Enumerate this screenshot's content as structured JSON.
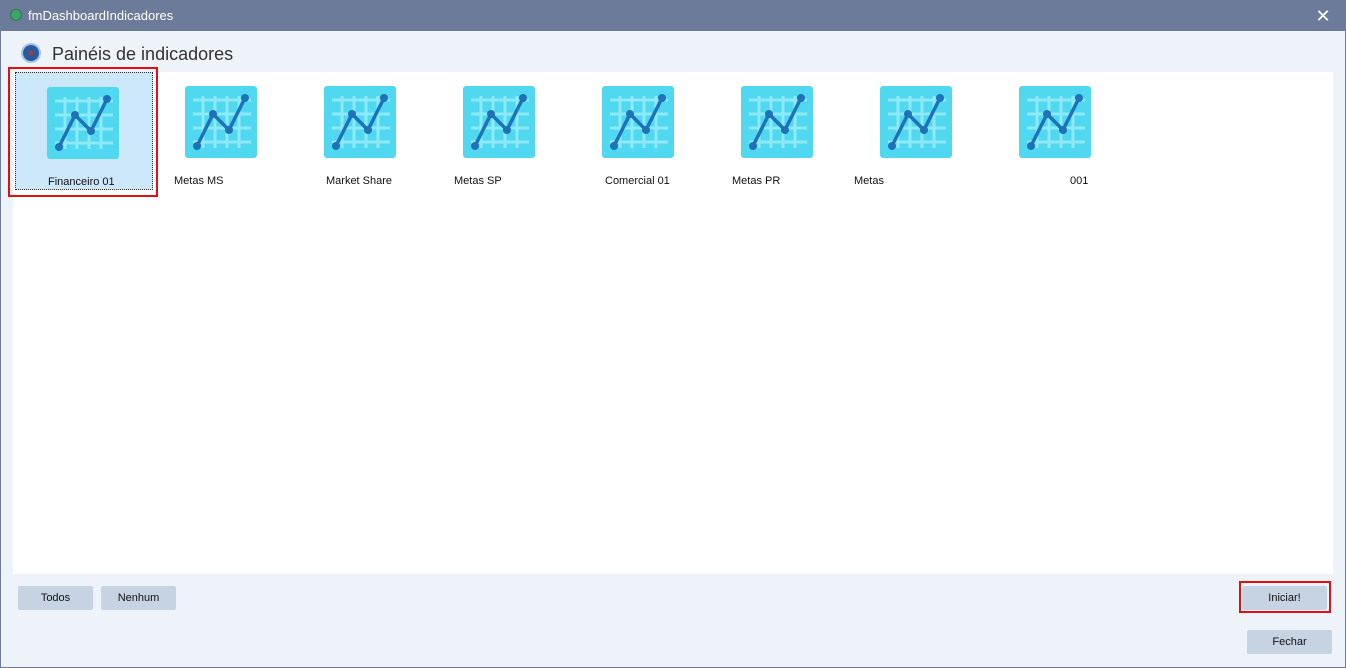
{
  "window": {
    "title": "fmDashboardIndicadores",
    "close_glyph": "✕"
  },
  "header": {
    "title": "Painéis de indicadores",
    "icon": "globe-icon"
  },
  "tiles": [
    {
      "label": "Financeiro 01",
      "selected": true,
      "icon": "chart-line-icon"
    },
    {
      "label": "Metas MS",
      "selected": false,
      "icon": "chart-line-icon"
    },
    {
      "label": "Market Share",
      "selected": false,
      "icon": "chart-line-icon"
    },
    {
      "label": "Metas SP",
      "selected": false,
      "icon": "chart-line-icon"
    },
    {
      "label": "Comercial 01",
      "selected": false,
      "icon": "chart-line-icon"
    },
    {
      "label": "Metas PR",
      "selected": false,
      "icon": "chart-line-icon"
    },
    {
      "label": "Metas",
      "selected": false,
      "icon": "chart-line-icon"
    },
    {
      "label": "001",
      "selected": false,
      "icon": "chart-line-icon"
    }
  ],
  "buttons": {
    "todos": "Todos",
    "nenhum": "Nenhum",
    "iniciar": "Iniciar!",
    "fechar": "Fechar"
  },
  "colors": {
    "titlebar": "#6c7b99",
    "tile_icon_bg": "#4fd8f0",
    "tile_icon_grid": "#8ee9f8",
    "tile_icon_line": "#1e72b8",
    "selection": "#cce6fa",
    "annotation": "#e01010",
    "button": "#c6d3e3"
  }
}
